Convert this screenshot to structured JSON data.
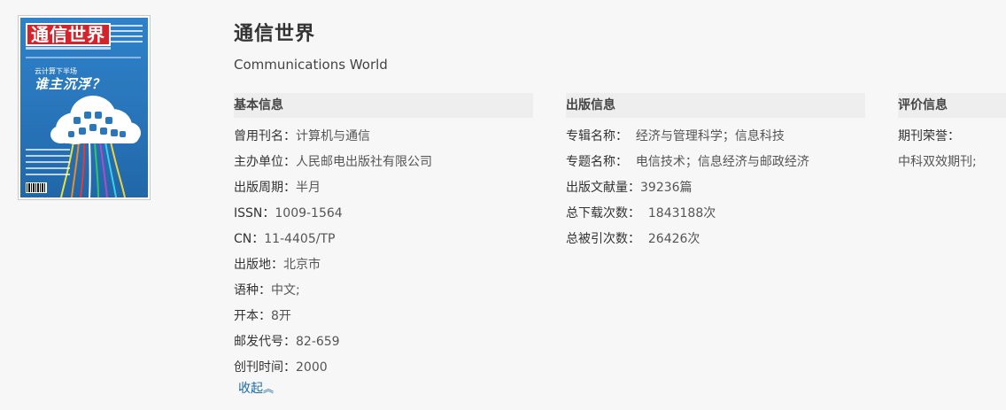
{
  "cover": {
    "masthead": "通信世界",
    "kicker": "云计算下半场",
    "headline": "谁主沉浮？",
    "colors": {
      "background": "#2a77bd",
      "masthead": "#d3242b"
    }
  },
  "journal": {
    "title": "通信世界",
    "english_title": "Communications World"
  },
  "basic_info": {
    "heading": "基本信息",
    "rows": [
      {
        "key": "曾用刊名：",
        "value": "计算机与通信"
      },
      {
        "key": "主办单位：",
        "value": "人民邮电出版社有限公司"
      },
      {
        "key": "出版周期：",
        "value": "半月"
      },
      {
        "key": "ISSN：",
        "value": "1009-1564"
      },
      {
        "key": "CN：",
        "value": "11-4405/TP"
      },
      {
        "key": "出版地：",
        "value": "北京市"
      },
      {
        "key": "语种：",
        "value": "中文;"
      },
      {
        "key": "开本：",
        "value": "8开"
      },
      {
        "key": "邮发代号：",
        "value": "82-659"
      },
      {
        "key": "创刊时间：",
        "value": "2000"
      }
    ]
  },
  "publish_info": {
    "heading": "出版信息",
    "rows": [
      {
        "key": "专辑名称：",
        "value": "  经济与管理科学；信息科技"
      },
      {
        "key": "专题名称：",
        "value": "  电信技术；信息经济与邮政经济"
      },
      {
        "key": "出版文献量：",
        "value": "39236篇"
      },
      {
        "key": "总下载次数：",
        "value": "  1843188次"
      },
      {
        "key": "总被引次数：",
        "value": "  26426次"
      }
    ]
  },
  "evaluation_info": {
    "heading": "评价信息",
    "rows": [
      {
        "key": "期刊荣誉：",
        "value": ""
      },
      {
        "key": "",
        "value": "中科双效期刊;"
      }
    ]
  },
  "collapse": {
    "label": "收起",
    "icon": "double-chevron-up-icon",
    "color": "#1a6aa8"
  }
}
